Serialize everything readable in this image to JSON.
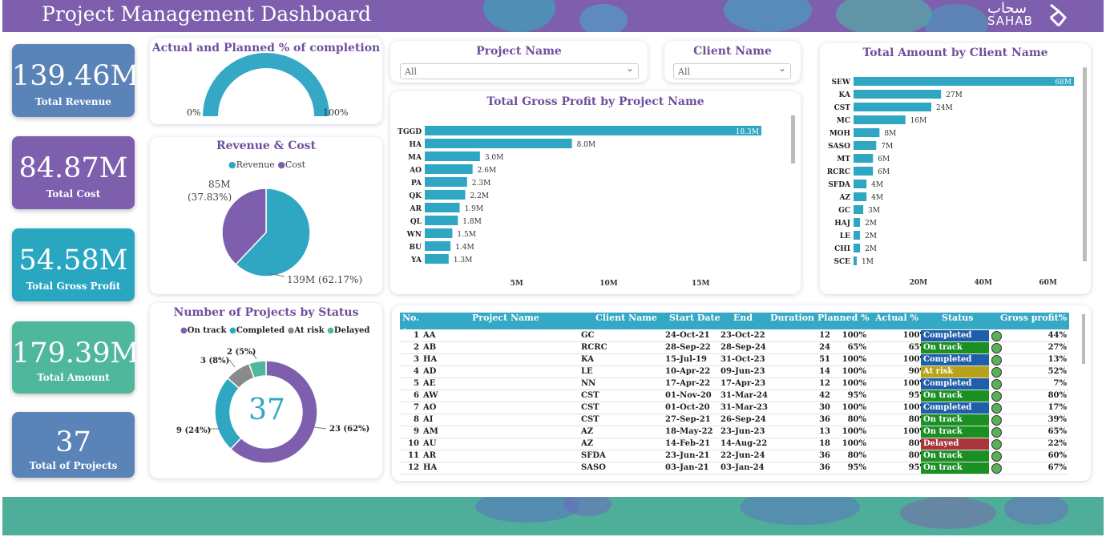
{
  "header": {
    "title": "Project Management Dashboard",
    "logo_arabic": "سحاب",
    "logo_english": "SAHAB"
  },
  "kpis": [
    {
      "value": "139.46M",
      "label": "Total Revenue",
      "color": "#5a83b8"
    },
    {
      "value": "84.87M",
      "label": "Total Cost",
      "color": "#7d5fae"
    },
    {
      "value": "54.58M",
      "label": "Total Gross Profit",
      "color": "#2aa7c0"
    },
    {
      "value": "179.39M",
      "label": "Total Amount",
      "color": "#4fb89c"
    },
    {
      "value": "37",
      "label": "Total of Projects",
      "color": "#5a83b8"
    }
  ],
  "gauge": {
    "title": "Actual and Planned % of completion",
    "min_label": "0%",
    "max_label": "100%",
    "value": 1.0
  },
  "revenue_cost": {
    "title": "Revenue & Cost",
    "legend": [
      "Revenue",
      "Cost"
    ],
    "cost_label": "85M",
    "cost_pct": "(37.83%)",
    "revenue_label": "139M (62.17%)",
    "chart_data": {
      "type": "pie",
      "categories": [
        "Revenue",
        "Cost"
      ],
      "values": [
        139,
        85
      ],
      "percents": [
        62.17,
        37.83
      ]
    }
  },
  "status_chart": {
    "title": "Number of Projects by Status",
    "legend": [
      "On track",
      "Completed",
      "At risk",
      "Delayed"
    ],
    "center": "37",
    "labels": {
      "on_track": "23 (62%)",
      "completed": "9 (24%)",
      "at_risk": "3 (8%)",
      "delayed": "2 (5%)"
    },
    "chart_data": {
      "type": "pie",
      "categories": [
        "On track",
        "Completed",
        "At risk",
        "Delayed"
      ],
      "values": [
        23,
        9,
        3,
        2
      ]
    }
  },
  "filters": {
    "project": {
      "title": "Project Name",
      "value": "All"
    },
    "client": {
      "title": "Client Name",
      "value": "All"
    }
  },
  "gross_profit": {
    "title": "Total Gross Profit by Project Name",
    "ticks": [
      "5M",
      "10M",
      "15M"
    ],
    "chart_data": {
      "type": "bar",
      "categories": [
        "TGGD",
        "HA",
        "MA",
        "AO",
        "PA",
        "QK",
        "AR",
        "QL",
        "WN",
        "BU",
        "YA"
      ],
      "values": [
        18.3,
        8.0,
        3.0,
        2.6,
        2.3,
        2.2,
        1.9,
        1.8,
        1.5,
        1.4,
        1.3
      ],
      "labels": [
        "18.3M",
        "8.0M",
        "3.0M",
        "2.6M",
        "2.3M",
        "2.2M",
        "1.9M",
        "1.8M",
        "1.5M",
        "1.4M",
        "1.3M"
      ]
    }
  },
  "client_amount": {
    "title": "Total Amount by Client Name",
    "ticks": [
      "20M",
      "40M",
      "60M"
    ],
    "chart_data": {
      "type": "bar",
      "categories": [
        "SEW",
        "KA",
        "CST",
        "MC",
        "MOH",
        "SASO",
        "MT",
        "RCRC",
        "SFDA",
        "AZ",
        "GC",
        "HAJ",
        "LE",
        "CHI",
        "SCE"
      ],
      "values": [
        68,
        27,
        24,
        16,
        8,
        7,
        6,
        6,
        4,
        4,
        3,
        2,
        2,
        2,
        1
      ],
      "labels": [
        "68M",
        "27M",
        "24M",
        "16M",
        "8M",
        "7M",
        "6M",
        "6M",
        "4M",
        "4M",
        "3M",
        "2M",
        "2M",
        "2M",
        "1M"
      ]
    }
  },
  "table": {
    "columns": [
      "No.",
      "Project Name",
      "Client Name",
      "Start Date",
      "End",
      "Duration",
      "Planned %",
      "Actual %",
      "Status",
      "Gross profit%"
    ],
    "status_colors": {
      "Completed": "#1f5ea8",
      "On track": "#1a8f22",
      "At risk": "#b8a21a",
      "Delayed": "#a8343c"
    },
    "rows": [
      {
        "no": "1",
        "project": "AA",
        "client": "GC",
        "start": "24-Oct-21",
        "end": "23-Oct-22",
        "duration": "12",
        "planned": "100%",
        "actual": "100%",
        "status": "Completed",
        "gp": "44%"
      },
      {
        "no": "2",
        "project": "AB",
        "client": "RCRC",
        "start": "28-Sep-22",
        "end": "28-Sep-24",
        "duration": "24",
        "planned": "65%",
        "actual": "65%",
        "status": "On track",
        "gp": "27%"
      },
      {
        "no": "3",
        "project": "HA",
        "client": "KA",
        "start": "15-Jul-19",
        "end": "31-Oct-23",
        "duration": "51",
        "planned": "100%",
        "actual": "100%",
        "status": "Completed",
        "gp": "13%"
      },
      {
        "no": "4",
        "project": "AD",
        "client": "LE",
        "start": "10-Apr-22",
        "end": "09-Jun-23",
        "duration": "14",
        "planned": "100%",
        "actual": "90%",
        "status": "At risk",
        "gp": "52%"
      },
      {
        "no": "5",
        "project": "AE",
        "client": "NN",
        "start": "17-Apr-22",
        "end": "17-Apr-23",
        "duration": "12",
        "planned": "100%",
        "actual": "100%",
        "status": "Completed",
        "gp": "7%"
      },
      {
        "no": "6",
        "project": "AW",
        "client": "CST",
        "start": "01-Nov-20",
        "end": "31-Mar-24",
        "duration": "42",
        "planned": "95%",
        "actual": "95%",
        "status": "On track",
        "gp": "80%"
      },
      {
        "no": "7",
        "project": "AO",
        "client": "CST",
        "start": "01-Oct-20",
        "end": "31-Mar-23",
        "duration": "30",
        "planned": "100%",
        "actual": "100%",
        "status": "Completed",
        "gp": "17%"
      },
      {
        "no": "8",
        "project": "AI",
        "client": "CST",
        "start": "27-Sep-21",
        "end": "26-Sep-24",
        "duration": "36",
        "planned": "80%",
        "actual": "80%",
        "status": "On track",
        "gp": "39%"
      },
      {
        "no": "9",
        "project": "AM",
        "client": "AZ",
        "start": "18-May-22",
        "end": "23-Jun-23",
        "duration": "13",
        "planned": "100%",
        "actual": "100%",
        "status": "On track",
        "gp": "65%"
      },
      {
        "no": "10",
        "project": "AU",
        "client": "AZ",
        "start": "14-Feb-21",
        "end": "14-Aug-22",
        "duration": "18",
        "planned": "100%",
        "actual": "80%",
        "status": "Delayed",
        "gp": "22%"
      },
      {
        "no": "11",
        "project": "AR",
        "client": "SFDA",
        "start": "23-Jun-21",
        "end": "22-Jun-24",
        "duration": "36",
        "planned": "80%",
        "actual": "80%",
        "status": "On track",
        "gp": "60%"
      },
      {
        "no": "12",
        "project": "HA",
        "client": "SASO",
        "start": "03-Jan-21",
        "end": "03-Jan-24",
        "duration": "36",
        "planned": "95%",
        "actual": "95%",
        "status": "On track",
        "gp": "67%"
      }
    ]
  },
  "colors": {
    "purple": "#7d5fae",
    "teal": "#2fa6c2",
    "grey": "#8a8a8a",
    "green": "#4fb89c"
  }
}
